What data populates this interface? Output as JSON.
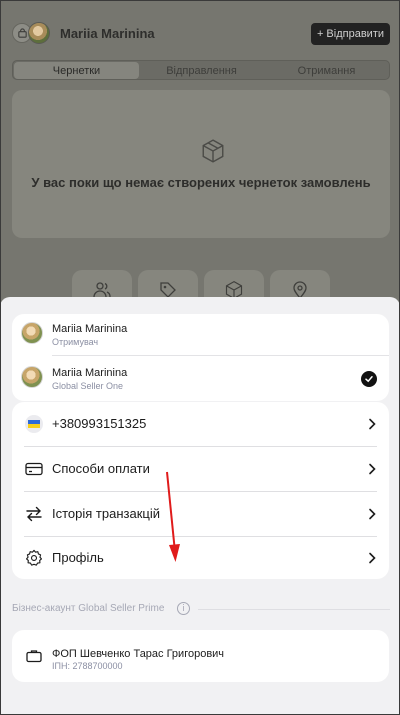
{
  "app": {
    "user_name": "Mariia Marinina",
    "send_button": "+ Відправити",
    "tabs": [
      {
        "label": "Чернетки",
        "active": true
      },
      {
        "label": "Відправлення",
        "active": false
      },
      {
        "label": "Отримання",
        "active": false
      }
    ],
    "empty_text": "У вас поки що немає створених чернеток замовлень",
    "quick_actions": [
      "users-icon",
      "tag-icon",
      "package-icon",
      "map-pin-icon"
    ]
  },
  "sheet": {
    "accounts": [
      {
        "name": "Mariia Marinina",
        "role": "Отримувач",
        "selected": false
      },
      {
        "name": "Mariia Marinina",
        "role": "Global Seller One",
        "selected": true
      }
    ],
    "phone": "+380993151325",
    "phone_flag": "ukraine-flag-icon",
    "menu": [
      {
        "label": "Способи оплати",
        "icon": "credit-card-icon"
      },
      {
        "label": "Історія транзакцій",
        "icon": "transfer-arrows-icon"
      },
      {
        "label": "Профіль",
        "icon": "gear-icon"
      }
    ],
    "business_section": "Бізнес-акаунт Global Seller Prime",
    "business": {
      "name": "ФОП Шевченко Тарас Григорович",
      "ipn": "ІПН: 2788700000",
      "icon": "briefcase-icon"
    }
  },
  "colors": {
    "overlay": "#76766f",
    "sheet_bg": "#f1f1f3",
    "card_bg": "#ffffff",
    "annotation_arrow": "#e01b1b"
  }
}
